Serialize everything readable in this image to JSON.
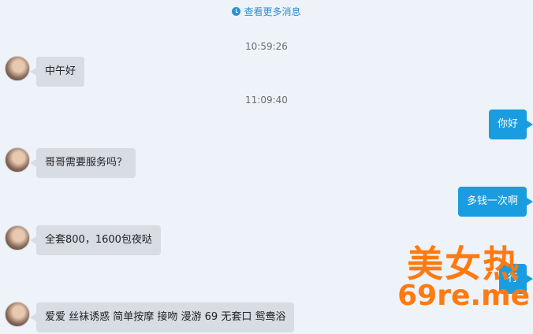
{
  "header": {
    "load_more": "查看更多消息"
  },
  "messages": {
    "time1": "10:59:26",
    "m1": "中午好",
    "time2": "11:09:40",
    "m2": "你好",
    "m3": "哥哥需要服务吗？",
    "m4": "多钱一次啊",
    "m5": "全套800，1600包夜哒",
    "m6": "行",
    "m7": "爱爱  丝袜诱惑  简单按摩   接吻  漫游  69  无套口  鸳鸯浴"
  },
  "watermark": {
    "line1": "美女热",
    "line2": "69re.me"
  },
  "colors": {
    "background": "#eef2f9",
    "outgoing": "#1a9de0",
    "incoming": "#d8dce3",
    "link": "#2f8fcf",
    "watermark": "#ff7a10"
  }
}
